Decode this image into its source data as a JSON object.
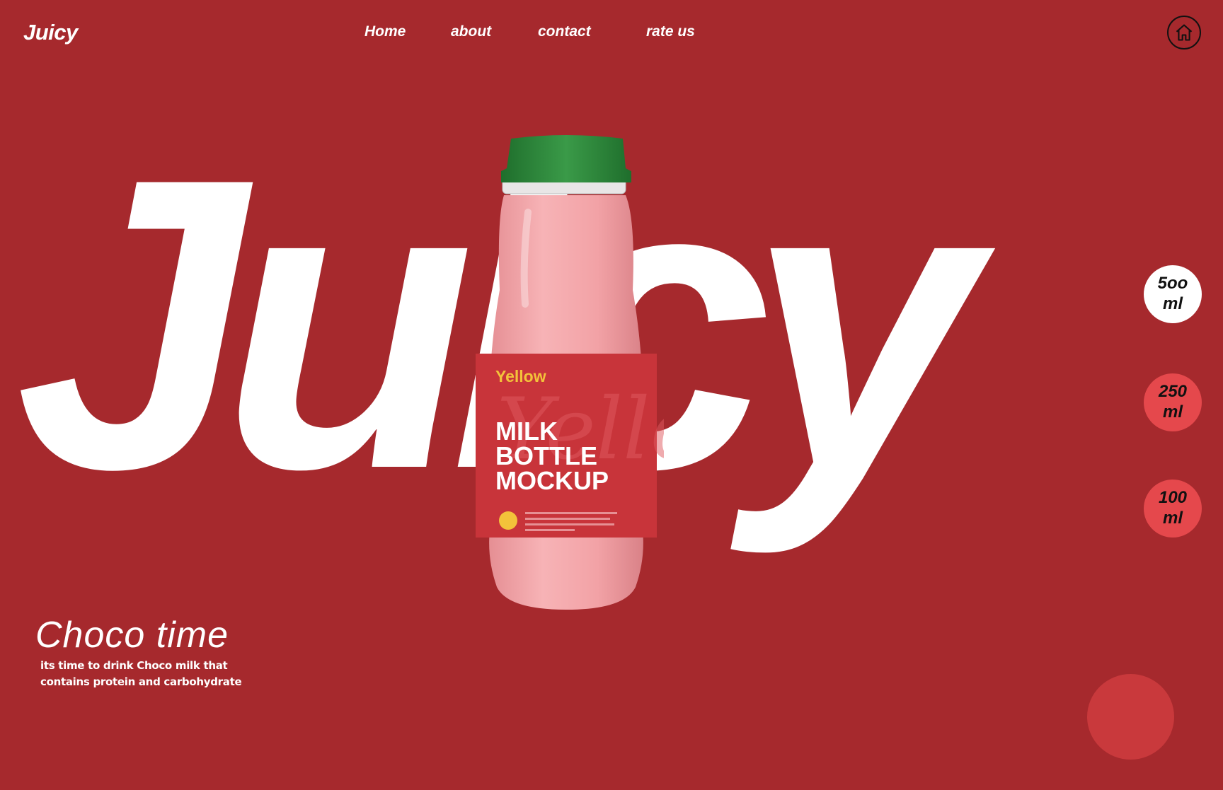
{
  "header": {
    "logo": "Juicy",
    "nav": [
      {
        "label": "Home"
      },
      {
        "label": "about"
      },
      {
        "label": "contact"
      },
      {
        "label": "rate us"
      }
    ],
    "home_icon": "home-icon"
  },
  "hero": {
    "big_word": "Juicy",
    "bottle": {
      "brand": "Yellow",
      "line1": "MILK",
      "line2": "BOTTLE",
      "line3": "MOCKUP",
      "label_script": "Yellow",
      "cap_color": "#2e8b3c",
      "liquid_color": "#f4a4a8",
      "label_color": "#c8343a"
    }
  },
  "sizes": [
    {
      "label": "5oo\nml",
      "active": true
    },
    {
      "label": "250\nml",
      "active": false
    },
    {
      "label": "100\nml",
      "active": false
    }
  ],
  "promo": {
    "title": "Choco time",
    "description": "its time to drink Choco milk that contains protein and carbohydrate"
  },
  "colors": {
    "background": "#a6292d",
    "accent": "#e5484c",
    "deco_circle": "#c9393c"
  }
}
